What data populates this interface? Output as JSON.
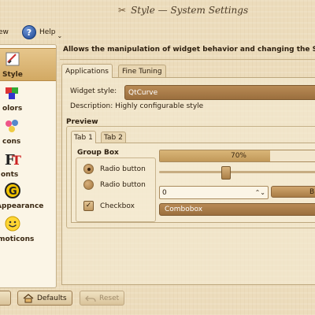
{
  "window": {
    "title": "Style — System Settings"
  },
  "toolbar": {
    "overview_label": "ew",
    "help_label": "Help"
  },
  "sidebar": {
    "items": [
      {
        "label": "Style",
        "icon": "style-icon",
        "selected": true
      },
      {
        "label": "olors",
        "icon": "colors-icon",
        "selected": false
      },
      {
        "label": "cons",
        "icon": "icons-icon",
        "selected": false
      },
      {
        "label": "onts",
        "icon": "fonts-icon",
        "selected": false
      },
      {
        "label": "Appearance",
        "icon": "appearance-icon",
        "selected": false
      },
      {
        "label": "Emoticons",
        "icon": "emoticons-icon",
        "selected": false
      }
    ]
  },
  "header": {
    "description": "Allows the manipulation of widget behavior and changing the St"
  },
  "tabs": [
    {
      "label": "Applications",
      "active": true
    },
    {
      "label": "Fine Tuning",
      "active": false
    }
  ],
  "applications": {
    "widget_style_label": "Widget style:",
    "widget_style_value": "QtCurve",
    "description_label": "Description:",
    "description_value": "Highly configurable style"
  },
  "preview": {
    "title": "Preview",
    "tabs": [
      {
        "label": "Tab 1",
        "active": true
      },
      {
        "label": "Tab 2",
        "active": false
      }
    ],
    "groupbox_title": "Group Box",
    "radio1": "Radio button",
    "radio2": "Radio button",
    "checkbox_label": "Checkbox",
    "checkbox_checked": true,
    "progress_text": "70%",
    "progress_fraction": 0.7,
    "slider_fraction": 0.42,
    "spin_value": "0",
    "button_label": "B",
    "combobox_value": "Combobox"
  },
  "bottom": {
    "defaults_label": "Defaults",
    "reset_label": "Reset"
  },
  "colors": {
    "accent": "#a57a45",
    "window_bg": "#ecdcbc"
  }
}
